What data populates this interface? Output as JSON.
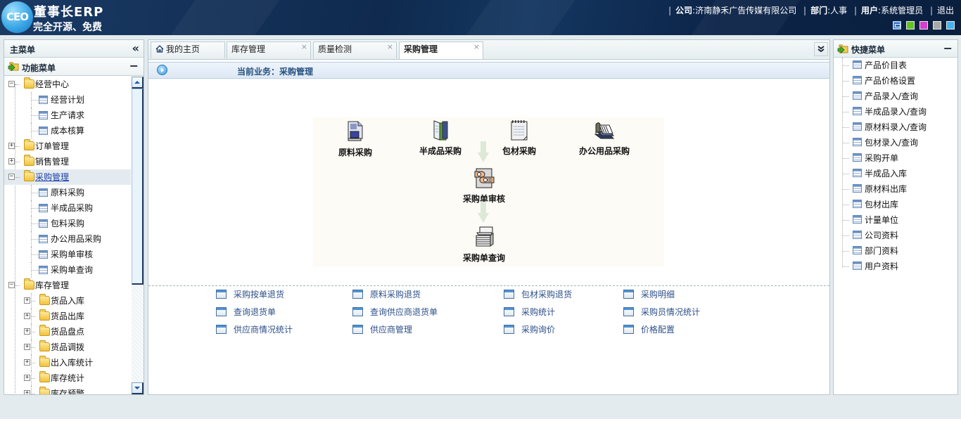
{
  "header": {
    "logo_badge": "CEO",
    "app_title": "董事长ERP",
    "tagline": "完全开源、免费",
    "company_label": "公司",
    "company_value": "济南静禾广告传媒有限公司",
    "dept_label": "部门",
    "dept_value": "人事",
    "user_label": "用户",
    "user_value": "系统管理员",
    "logout": "退出",
    "skins": [
      {
        "name": "blue",
        "color": "#2a63b4",
        "active": true
      },
      {
        "name": "green",
        "color": "#62c41c",
        "active": false
      },
      {
        "name": "pink",
        "color": "#d43fcb",
        "active": false
      },
      {
        "name": "gray",
        "color": "#a8a8a8",
        "active": false
      },
      {
        "name": "sky",
        "color": "#43b4f2",
        "active": false
      }
    ]
  },
  "left_panel": {
    "title": "主菜单",
    "collapse_icon": "double-chevron-left-icon",
    "section_title": "功能菜单",
    "tree": [
      {
        "label": "经营中心",
        "type": "folder",
        "level": 0,
        "expanded": true
      },
      {
        "label": "经营计划",
        "type": "page",
        "level": 1
      },
      {
        "label": "生产请求",
        "type": "page",
        "level": 1
      },
      {
        "label": "成本核算",
        "type": "page",
        "level": 1
      },
      {
        "label": "订单管理",
        "type": "folder",
        "level": 0,
        "expanded": false
      },
      {
        "label": "销售管理",
        "type": "folder",
        "level": 0,
        "expanded": false
      },
      {
        "label": "采购管理",
        "type": "folder",
        "level": 0,
        "expanded": true,
        "selected": true
      },
      {
        "label": "原料采购",
        "type": "page",
        "level": 1
      },
      {
        "label": "半成品采购",
        "type": "page",
        "level": 1
      },
      {
        "label": "包料采购",
        "type": "page",
        "level": 1
      },
      {
        "label": "办公用品采购",
        "type": "page",
        "level": 1
      },
      {
        "label": "采购单审核",
        "type": "page",
        "level": 1
      },
      {
        "label": "采购单查询",
        "type": "page",
        "level": 1
      },
      {
        "label": "库存管理",
        "type": "folder",
        "level": 0,
        "expanded": true
      },
      {
        "label": "货品入库",
        "type": "folder",
        "level": 1,
        "expanded": false
      },
      {
        "label": "货品出库",
        "type": "folder",
        "level": 1,
        "expanded": false
      },
      {
        "label": "货品盘点",
        "type": "folder",
        "level": 1,
        "expanded": false
      },
      {
        "label": "货品调拨",
        "type": "folder",
        "level": 1,
        "expanded": false
      },
      {
        "label": "出入库统计",
        "type": "folder",
        "level": 1,
        "expanded": false
      },
      {
        "label": "库存统计",
        "type": "folder",
        "level": 1,
        "expanded": false
      },
      {
        "label": "库存预警",
        "type": "folder",
        "level": 1,
        "expanded": false
      }
    ]
  },
  "tabs": [
    {
      "label": "我的主页",
      "closable": false,
      "icon": "home-icon"
    },
    {
      "label": "库存管理",
      "closable": true
    },
    {
      "label": "质量检测",
      "closable": true
    },
    {
      "label": "采购管理",
      "closable": true,
      "active": true
    }
  ],
  "tab_close_glyph": "×",
  "tab_menu_glyph": "»",
  "business_bar": {
    "text": "当前业务：采购管理"
  },
  "flow": {
    "items": [
      {
        "label": "原料采购",
        "icon": "computer-document-icon"
      },
      {
        "label": "半成品采购",
        "icon": "binder-icon"
      },
      {
        "label": "包材采购",
        "icon": "notepad-icon"
      },
      {
        "label": "办公用品采购",
        "icon": "address-book-icon"
      },
      {
        "label": "采购单审核",
        "icon": "approval-hand-icon"
      },
      {
        "label": "采购单查询",
        "icon": "document-stack-icon"
      }
    ]
  },
  "quick_links": [
    [
      "采购按单退货",
      "原料采购退货",
      "包材采购退货",
      "采购明细"
    ],
    [
      "查询退货单",
      "查询供应商退货单",
      "采购统计",
      "采购员情况统计"
    ],
    [
      "供应商情况统计",
      "供应商管理",
      "采购询价",
      "价格配置"
    ]
  ],
  "right_panel": {
    "title": "快捷菜单",
    "collapse_glyph": "−",
    "items": [
      "产品价目表",
      "产品价格设置",
      "产品录入/查询",
      "半成品录入/查询",
      "原材料录入/查询",
      "包材录入/查询",
      "采购开单",
      "半成品入库",
      "原材料出库",
      "包材出库",
      "计量单位",
      "公司资料",
      "部门资料",
      "用户资料"
    ]
  },
  "glyphs": {
    "minus": "−",
    "plus": "+",
    "collapse_left": "«"
  }
}
